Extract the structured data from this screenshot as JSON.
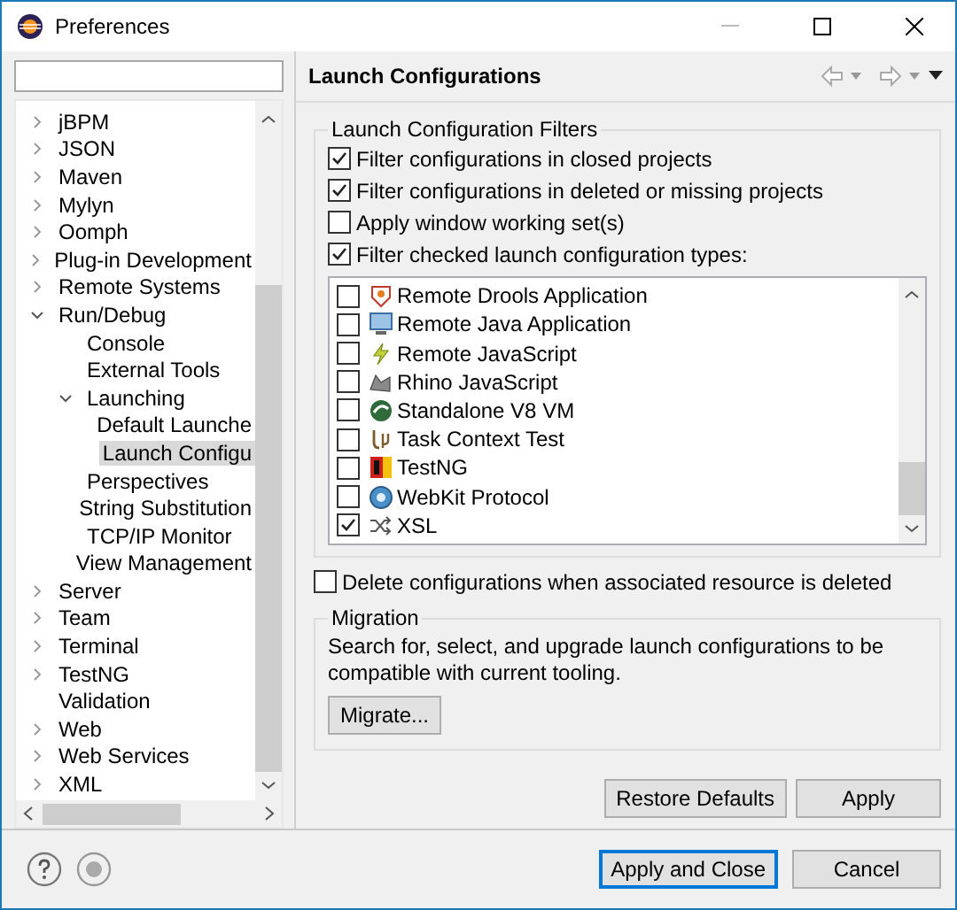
{
  "window": {
    "title": "Preferences"
  },
  "tree": [
    {
      "label": "jBPM",
      "expanded": false,
      "selected": false
    },
    {
      "label": "JSON",
      "expanded": false,
      "selected": false
    },
    {
      "label": "Maven",
      "expanded": false,
      "selected": false
    },
    {
      "label": "Mylyn",
      "expanded": false,
      "selected": false
    },
    {
      "label": "Oomph",
      "expanded": false,
      "selected": false
    },
    {
      "label": "Plug-in Development",
      "expanded": false,
      "selected": false
    },
    {
      "label": "Remote Systems",
      "expanded": false,
      "selected": false
    },
    {
      "label": "Run/Debug",
      "expanded": true,
      "selected": false,
      "children": [
        {
          "label": "Console",
          "selected": false
        },
        {
          "label": "External Tools",
          "selected": false
        },
        {
          "label": "Launching",
          "expanded": true,
          "selected": false,
          "children": [
            {
              "label": "Default Launche",
              "selected": false
            },
            {
              "label": "Launch Configu",
              "selected": true
            }
          ]
        },
        {
          "label": "Perspectives",
          "selected": false
        },
        {
          "label": "String Substitution",
          "selected": false
        },
        {
          "label": "TCP/IP Monitor",
          "selected": false
        },
        {
          "label": "View Management",
          "selected": false
        }
      ]
    },
    {
      "label": "Server",
      "expanded": false,
      "selected": false
    },
    {
      "label": "Team",
      "expanded": false,
      "selected": false
    },
    {
      "label": "Terminal",
      "expanded": false,
      "selected": false
    },
    {
      "label": "TestNG",
      "expanded": false,
      "selected": false
    },
    {
      "label": "Validation",
      "selected": false
    },
    {
      "label": "Web",
      "expanded": false,
      "selected": false
    },
    {
      "label": "Web Services",
      "expanded": false,
      "selected": false
    },
    {
      "label": "XML",
      "expanded": false,
      "selected": false
    }
  ],
  "page": {
    "title": "Launch Configurations",
    "filters": {
      "title": "Launch Configuration Filters",
      "options": [
        {
          "label": "Filter configurations in closed projects",
          "checked": true
        },
        {
          "label": "Filter configurations in deleted or missing projects",
          "checked": true
        },
        {
          "label": "Apply window working set(s)",
          "checked": false
        },
        {
          "label": "Filter checked launch configuration types:",
          "checked": true
        }
      ],
      "types": [
        {
          "label": "Remote Drools Application",
          "checked": false
        },
        {
          "label": "Remote Java Application",
          "checked": false
        },
        {
          "label": "Remote JavaScript",
          "checked": false
        },
        {
          "label": "Rhino JavaScript",
          "checked": false
        },
        {
          "label": "Standalone V8 VM",
          "checked": false
        },
        {
          "label": "Task Context Test",
          "checked": false
        },
        {
          "label": "TestNG",
          "checked": false
        },
        {
          "label": "WebKit Protocol",
          "checked": false
        },
        {
          "label": "XSL",
          "checked": true
        }
      ]
    },
    "delete_option": {
      "label": "Delete configurations when associated resource is deleted",
      "checked": false
    },
    "migration": {
      "title": "Migration",
      "text": "Search for, select, and upgrade launch configurations to be compatible with current tooling.",
      "button": "Migrate..."
    },
    "buttons": [
      "Restore Defaults",
      "Apply"
    ]
  },
  "footer_buttons": [
    {
      "label": "Apply and Close",
      "default": true
    },
    {
      "label": "Cancel",
      "default": false
    }
  ]
}
